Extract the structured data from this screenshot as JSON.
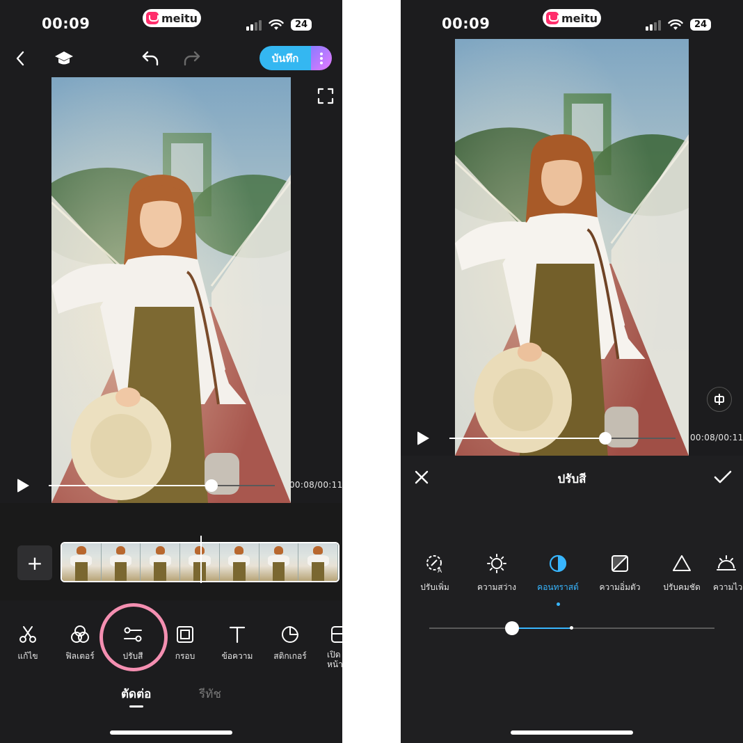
{
  "left_screen": {
    "status": {
      "time": "00:09",
      "brand": "meitu",
      "battery": "24"
    },
    "toolbar": {
      "save_label": "บันทึก"
    },
    "playback": {
      "time": "00:08/00:11",
      "progress": 0.72
    },
    "tools": [
      {
        "label": "แก้ไข",
        "icon": "scissors-icon"
      },
      {
        "label": "ฟิลเตอร์",
        "icon": "filter-icon"
      },
      {
        "label": "ปรับสี",
        "icon": "adjust-sliders-icon"
      },
      {
        "label": "กรอบ",
        "icon": "frame-icon"
      },
      {
        "label": "ข้อความ",
        "icon": "text-icon"
      },
      {
        "label": "สติกเกอร์",
        "icon": "sticker-icon"
      },
      {
        "label": "เปิด หน้า",
        "icon": "cover-icon"
      }
    ],
    "bottom_tabs": {
      "edit": "ตัดต่อ",
      "retouch": "รีทัช"
    },
    "colors": {
      "accent": "#34b7f1",
      "highlight": "#f48fb1"
    }
  },
  "right_screen": {
    "status": {
      "time": "00:09",
      "brand": "meitu",
      "battery": "24"
    },
    "playback": {
      "time": "00:08/00:11",
      "progress": 0.69
    },
    "panel": {
      "title": "ปรับสี",
      "items": [
        {
          "label": "ปรับเพิ่ม",
          "icon": "auto-enhance-icon"
        },
        {
          "label": "ความสว่าง",
          "icon": "brightness-sun-icon"
        },
        {
          "label": "คอนทราสต์",
          "icon": "contrast-icon",
          "active": true
        },
        {
          "label": "ความอิ่มตัว",
          "icon": "saturation-icon"
        },
        {
          "label": "ปรับคมชัด",
          "icon": "sharpen-triangle-icon"
        },
        {
          "label": "ความไว",
          "icon": "sensitivity-icon"
        }
      ],
      "slider_value": 0.29
    },
    "colors": {
      "accent": "#38b6ff"
    }
  }
}
